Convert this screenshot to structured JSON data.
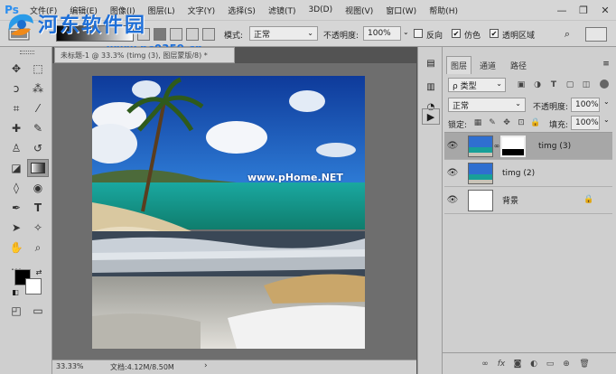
{
  "app": {
    "logo": "Ps"
  },
  "watermark": {
    "title": "河东软件园",
    "url": "www.pc0359.cn"
  },
  "menu": {
    "items": [
      "文件(F)",
      "编辑(E)",
      "图像(I)",
      "图层(L)",
      "文字(Y)",
      "选择(S)",
      "滤镜(T)",
      "3D(D)",
      "视图(V)",
      "窗口(W)",
      "帮助(H)"
    ]
  },
  "window_controls": {
    "minimize": "—",
    "restore": "❐",
    "close": "✕"
  },
  "options": {
    "mode_label": "模式:",
    "mode_value": "正常",
    "opacity_label": "不透明度:",
    "opacity_value": "100%",
    "reverse_label": "反向",
    "reverse_checked": false,
    "dither_label": "仿色",
    "dither_checked": true,
    "transparency_label": "透明区域",
    "transparency_checked": true
  },
  "document": {
    "tab_title": "未标题-1 @ 33.3% (timg (3), 图层蒙版/8) *",
    "zoom": "33.33%",
    "doc_info": "文档:4.12M/8.50M",
    "image_watermark": "www.pHome.NET"
  },
  "layers_panel": {
    "tabs": [
      "图层",
      "通道",
      "路径"
    ],
    "filter_label": "ρ 类型",
    "blend_mode": "正常",
    "opacity_label": "不透明度:",
    "opacity_value": "100%",
    "lock_label": "锁定:",
    "fill_label": "填充:",
    "fill_value": "100%",
    "layers": [
      {
        "name": "timg (3)",
        "selected": true,
        "has_mask": true,
        "locked": false
      },
      {
        "name": "timg (2)",
        "selected": false,
        "has_mask": false,
        "locked": false
      },
      {
        "name": "背景",
        "selected": false,
        "has_mask": false,
        "locked": true
      }
    ],
    "footer_icons": [
      "link-icon",
      "fx-icon",
      "mask-icon",
      "adjustment-icon",
      "group-icon",
      "new-layer-icon",
      "trash-icon"
    ]
  },
  "colors": {
    "menubar_bg": "#d6d6d6",
    "canvas_bg": "#6e6e6e",
    "selected_layer": "#a7a7a7",
    "ps_blue": "#2a8ef0"
  }
}
